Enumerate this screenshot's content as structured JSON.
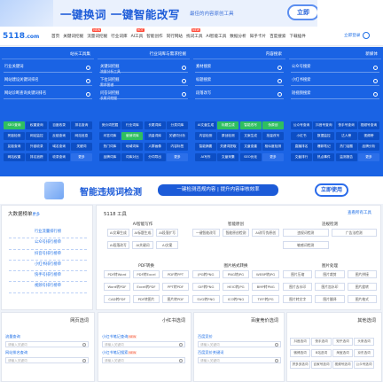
{
  "banner": {
    "title": "一键换词 一键智能改写",
    "subtitle": "最佳的内容原创工具",
    "button": "立即"
  },
  "nav": {
    "logo": "5118",
    "logo_suffix": ".com",
    "items": [
      {
        "label": "首页"
      },
      {
        "label": "关键词挖掘"
      },
      {
        "label": "流量词挖掘",
        "hot": "NEW"
      },
      {
        "label": "行业词库"
      },
      {
        "label": "AI工具",
        "hot": "HOT"
      },
      {
        "label": "智能创作"
      },
      {
        "label": "同行网站"
      },
      {
        "label": "找词工具",
        "hot": "NEW"
      },
      {
        "label": "AI智能工具"
      },
      {
        "label": "数据分析"
      },
      {
        "label": "知乎卡片"
      },
      {
        "label": "百度搜索"
      },
      {
        "label": "下载插件"
      }
    ],
    "login": "立即登录"
  },
  "tools": [
    {
      "header": "站长工具集",
      "inputs": [
        {
          "label": "行业关键词"
        },
        {
          "label": "网站建设关键词排名"
        },
        {
          "label": "网站诊断查询关键词排名"
        }
      ],
      "buttons": [
        {
          "label": "SEO查询",
          "style": "g"
        },
        {
          "label": "权重查询"
        },
        {
          "label": "百度收录"
        },
        {
          "label": "排名查询"
        },
        {
          "label": "死链检测"
        },
        {
          "label": "网站监控"
        },
        {
          "label": "反链查询"
        },
        {
          "label": "网站信息"
        },
        {
          "label": "友链查询"
        },
        {
          "label": "外链收录"
        },
        {
          "label": "域名查询"
        },
        {
          "label": "关键词"
        },
        {
          "label": "网站权重"
        },
        {
          "label": "排名追踪"
        },
        {
          "label": "收录查询"
        },
        {
          "label": "更多",
          "style": "more"
        }
      ]
    },
    {
      "header": "行业词库与需求挖掘",
      "inputs": [
        {
          "label": "关键词挖掘",
          "sub": "流量分析工具"
        },
        {
          "label": "下拉词挖掘",
          "sub": "需求图谱"
        },
        {
          "label": "问答词挖掘",
          "sub": "长尾词挖掘"
        }
      ],
      "buttons": [
        {
          "label": "竞价词挖掘"
        },
        {
          "label": "行业词库"
        },
        {
          "label": "长尾词库"
        },
        {
          "label": "分类词库"
        },
        {
          "label": "问答词库"
        },
        {
          "label": "营销词库",
          "style": "g"
        },
        {
          "label": "流量词库"
        },
        {
          "label": "关键词分析"
        },
        {
          "label": "热门词库"
        },
        {
          "label": "地域词库"
        },
        {
          "label": "人群画像"
        },
        {
          "label": "内容标签"
        },
        {
          "label": "品牌词库"
        },
        {
          "label": "词库对比"
        },
        {
          "label": "分词导出"
        },
        {
          "label": "更多",
          "style": "more"
        }
      ]
    },
    {
      "header": "内容搜索",
      "inputs": [
        {
          "label": "素材搜索"
        },
        {
          "label": "标题搜索"
        },
        {
          "label": "段落改写"
        }
      ],
      "buttons": [
        {
          "label": "AI文章生成"
        },
        {
          "label": "标题生成",
          "style": "g"
        },
        {
          "label": "智能改写",
          "style": "g"
        },
        {
          "label": "伪原创",
          "style": "g"
        },
        {
          "label": "内容检测"
        },
        {
          "label": "原创检测"
        },
        {
          "label": "文案生成"
        },
        {
          "label": "批量改写"
        },
        {
          "label": "智能摘要"
        },
        {
          "label": "关键词提取"
        },
        {
          "label": "文章查重"
        },
        {
          "label": "相似度检测"
        },
        {
          "label": "AI写作"
        },
        {
          "label": "文章采集"
        },
        {
          "label": "SEO优化"
        },
        {
          "label": "更多",
          "style": "more"
        }
      ]
    },
    {
      "header": "新媒体",
      "inputs": [
        {
          "label": "公众号搜索"
        },
        {
          "label": "小红书搜索"
        },
        {
          "label": "短视频搜索"
        }
      ],
      "buttons": [
        {
          "label": "公众号查询"
        },
        {
          "label": "抖音号查询"
        },
        {
          "label": "快手号查询"
        },
        {
          "label": "视频号查询"
        },
        {
          "label": "小红书"
        },
        {
          "label": "数据监控"
        },
        {
          "label": "达人榜"
        },
        {
          "label": "视频榜"
        },
        {
          "label": "直播排名"
        },
        {
          "label": "爆款笔记"
        },
        {
          "label": "热门话题"
        },
        {
          "label": "品牌分析"
        },
        {
          "label": "文章排行"
        },
        {
          "label": "热点事件"
        },
        {
          "label": "监测报告"
        },
        {
          "label": "更多",
          "style": "more"
        }
      ]
    }
  ],
  "banner2": {
    "title": "智能违规词检测",
    "pill": "一键检测违规内容 | 提升内容审核效率",
    "button": "立即使用"
  },
  "left_panel": {
    "title": "大数据榜单",
    "more": "更多",
    "links": [
      "行业流量排行榜",
      "公众号排行榜单",
      "抖音号排行榜单",
      "小红书排行榜单",
      "快手号排行榜单",
      "视频号排行榜单"
    ]
  },
  "right_panel": {
    "title": "5118 工具",
    "all": "查看所有工具",
    "groups": [
      {
        "title": "AI智能写作",
        "buttons": [
          "AI文章生成",
          "AI标题生成",
          "AI段落扩写",
          "AI段落改写",
          "AI关键词",
          "AI文案"
        ]
      },
      {
        "title": "智能原创",
        "buttons": [
          "一键智能改写",
          "智能原创检测",
          "AI改写伪原创"
        ]
      },
      {
        "title": "违规检测",
        "buttons": [
          "违规词检测",
          "广告法检测",
          "敏感词检测"
        ]
      },
      {
        "title": "PDF转换",
        "buttons": [
          "PDF转Word",
          "PDF转Excel",
          "PDF转PPT",
          "Word转PDF",
          "Excel转PDF",
          "PPT转PDF",
          "CAD转PDF",
          "PDF转图片",
          "图片转PDF"
        ]
      },
      {
        "title": "图片格式转换",
        "buttons": [
          "JPG转PNG",
          "PNG转JPG",
          "WEBP转JPG",
          "GIF转PNG",
          "HEIC转JPG",
          "BMP转PNG",
          "SVG转PNG",
          "ICO转PNG",
          "TIFF转JPG"
        ]
      },
      {
        "title": "图片处理",
        "buttons": [
          "图片压缩",
          "图片裁剪",
          "图片拼接",
          "图片去水印",
          "图片加水印",
          "图片旋转",
          "图片转文字",
          "图片翻译",
          "图片格式"
        ]
      }
    ]
  },
  "bottom": [
    {
      "title": "网页选词",
      "fields": [
        {
          "label": "流量查询"
        },
        {
          "label": "网站排名查询",
          "tag": ""
        }
      ]
    },
    {
      "title": "小红书选词",
      "fields": [
        {
          "label": "小红书笔记查询",
          "tag": "NEW"
        },
        {
          "label": "小红书笔记搜索",
          "tag": "NEW"
        }
      ]
    },
    {
      "title": "百度竞价选词",
      "fields": [
        {
          "label": "百度竞价"
        },
        {
          "label": "百度竞价关键词"
        }
      ]
    },
    {
      "title": "其他选词",
      "buttons": [
        "抖音选词",
        "快手选词",
        "知乎选词",
        "头条选词",
        "微博选词",
        "B站选词",
        "淘宝选词",
        "京东选词",
        "拼多多选词",
        "百家号选词",
        "视频号选词",
        "公众号选词"
      ]
    }
  ],
  "placeholder": "请输入关键词"
}
